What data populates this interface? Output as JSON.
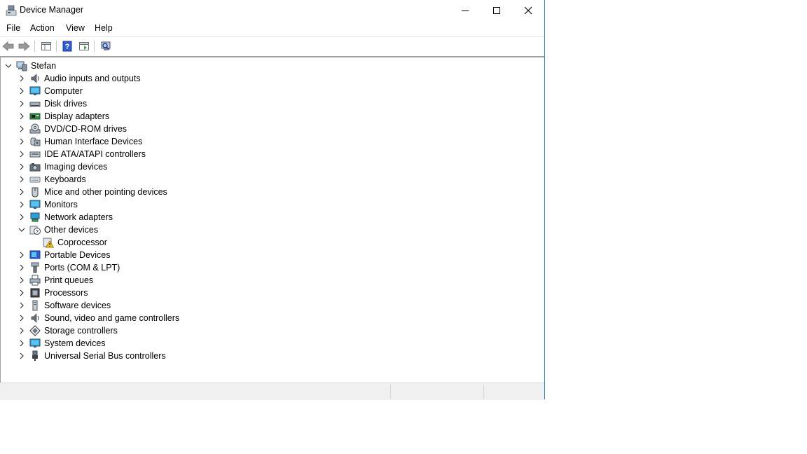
{
  "window": {
    "title": "Device Manager"
  },
  "menu": [
    "File",
    "Action",
    "View",
    "Help"
  ],
  "tree": {
    "root": "Stefan",
    "categories": [
      {
        "label": "Audio inputs and outputs",
        "icon": "speaker-icon",
        "expanded": false
      },
      {
        "label": "Computer",
        "icon": "monitor-icon",
        "expanded": false
      },
      {
        "label": "Disk drives",
        "icon": "disk-drive-icon",
        "expanded": false
      },
      {
        "label": "Display adapters",
        "icon": "display-adapter-icon",
        "expanded": false
      },
      {
        "label": "DVD/CD-ROM drives",
        "icon": "dvd-icon",
        "expanded": false
      },
      {
        "label": "Human Interface Devices",
        "icon": "hid-icon",
        "expanded": false
      },
      {
        "label": "IDE ATA/ATAPI controllers",
        "icon": "ide-controller-icon",
        "expanded": false
      },
      {
        "label": "Imaging devices",
        "icon": "camera-icon",
        "expanded": false
      },
      {
        "label": "Keyboards",
        "icon": "keyboard-icon",
        "expanded": false
      },
      {
        "label": "Mice and other pointing devices",
        "icon": "mouse-icon",
        "expanded": false
      },
      {
        "label": "Monitors",
        "icon": "monitor-icon",
        "expanded": false
      },
      {
        "label": "Network adapters",
        "icon": "network-icon",
        "expanded": false
      },
      {
        "label": "Other devices",
        "icon": "unknown-device-icon",
        "expanded": true,
        "children": [
          {
            "label": "Coprocessor",
            "icon": "warning-device-icon"
          }
        ]
      },
      {
        "label": "Portable Devices",
        "icon": "portable-device-icon",
        "expanded": false
      },
      {
        "label": "Ports (COM & LPT)",
        "icon": "port-icon",
        "expanded": false
      },
      {
        "label": "Print queues",
        "icon": "printer-icon",
        "expanded": false
      },
      {
        "label": "Processors",
        "icon": "processor-icon",
        "expanded": false
      },
      {
        "label": "Software devices",
        "icon": "software-device-icon",
        "expanded": false
      },
      {
        "label": "Sound, video and game controllers",
        "icon": "speaker-icon",
        "expanded": false
      },
      {
        "label": "Storage controllers",
        "icon": "storage-icon",
        "expanded": false
      },
      {
        "label": "System devices",
        "icon": "monitor-icon",
        "expanded": false
      },
      {
        "label": "Universal Serial Bus controllers",
        "icon": "usb-icon",
        "expanded": false
      }
    ]
  },
  "colors": {
    "accent": "#1883d7",
    "monitor": "#2a9fd8",
    "warning": "#f5c400"
  }
}
